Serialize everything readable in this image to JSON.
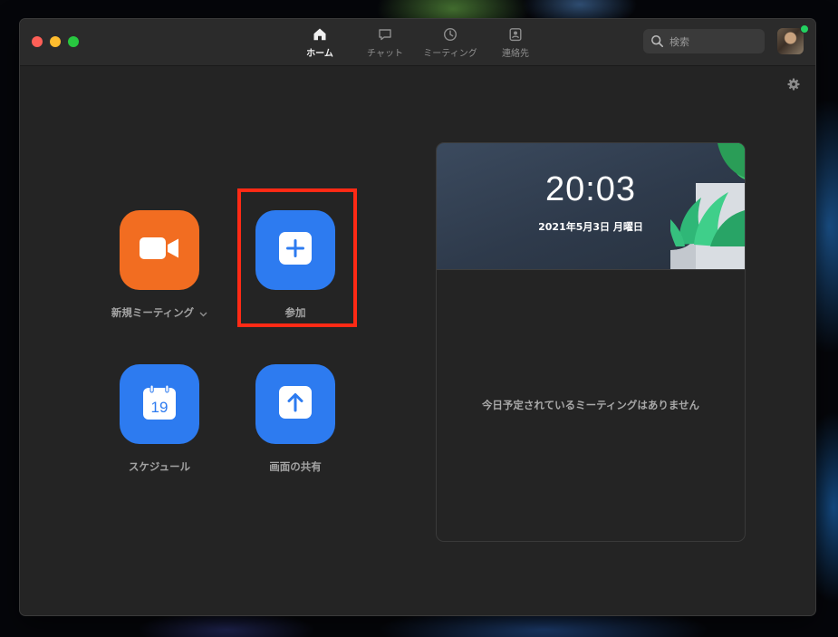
{
  "window": {
    "traffic_lights": [
      "close",
      "minimize",
      "zoom"
    ]
  },
  "nav": {
    "tabs": [
      {
        "label": "ホーム",
        "icon": "home-icon",
        "active": true
      },
      {
        "label": "チャット",
        "icon": "chat-icon",
        "active": false
      },
      {
        "label": "ミーティング",
        "icon": "clock-icon",
        "active": false
      },
      {
        "label": "連絡先",
        "icon": "contacts-icon",
        "active": false
      }
    ]
  },
  "search": {
    "placeholder": "検索",
    "value": ""
  },
  "profile": {
    "icon": "avatar",
    "status_color": "#23d160"
  },
  "actions": [
    {
      "label": "新規ミーティング",
      "icon": "video-camera-icon",
      "color": "#f26d21",
      "has_dropdown": true
    },
    {
      "label": "参加",
      "icon": "plus-icon",
      "color": "#2D7BF0",
      "highlighted": true
    },
    {
      "label": "スケジュール",
      "icon": "calendar-icon",
      "calendar_day": "19",
      "color": "#2D7BF0"
    },
    {
      "label": "画面の共有",
      "icon": "share-screen-icon",
      "color": "#2D7BF0"
    }
  ],
  "schedule_panel": {
    "time": "20:03",
    "date": "2021年5月3日 月曜日",
    "empty_message": "今日予定されているミーティングはありません"
  },
  "colors": {
    "highlight_border": "#ff2a15",
    "accent_blue": "#2D7BF0",
    "accent_orange": "#f26d21"
  }
}
